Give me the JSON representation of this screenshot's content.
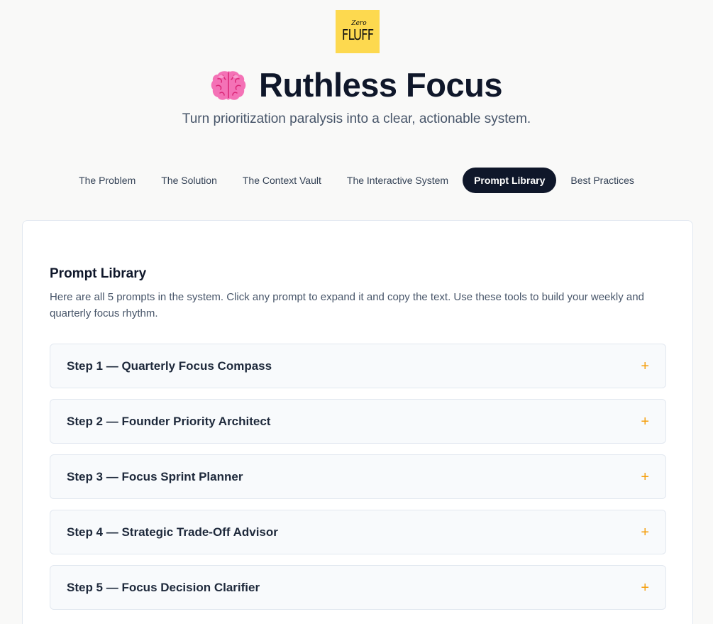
{
  "logo": {
    "script_text": "Zero",
    "main_text": "FLUFF",
    "bg_color": "#fdd94f"
  },
  "hero": {
    "icon": "brain-icon",
    "title": "Ruthless Focus",
    "subtitle": "Turn prioritization paralysis into a clear, actionable system."
  },
  "nav": {
    "tabs": [
      {
        "label": "The Problem",
        "active": false
      },
      {
        "label": "The Solution",
        "active": false
      },
      {
        "label": "The Context Vault",
        "active": false
      },
      {
        "label": "The Interactive System",
        "active": false
      },
      {
        "label": "Prompt Library",
        "active": true
      },
      {
        "label": "Best Practices",
        "active": false
      }
    ],
    "active_color": "#0f172a"
  },
  "library": {
    "title": "Prompt Library",
    "description": "Here are all 5 prompts in the system. Click any prompt to expand it and copy the text. Use these tools to build your weekly and quarterly focus rhythm.",
    "items": [
      {
        "label": "Step 1 — Quarterly Focus Compass",
        "icon": "plus-icon"
      },
      {
        "label": "Step 2 — Founder Priority Architect",
        "icon": "plus-icon"
      },
      {
        "label": "Step 3 — Focus Sprint Planner",
        "icon": "plus-icon"
      },
      {
        "label": "Step 4 — Strategic Trade-Off Advisor",
        "icon": "plus-icon"
      },
      {
        "label": "Step 5 — Focus Decision Clarifier",
        "icon": "plus-icon"
      }
    ],
    "accent_color": "#f59e0b",
    "expand_symbol": "+"
  }
}
